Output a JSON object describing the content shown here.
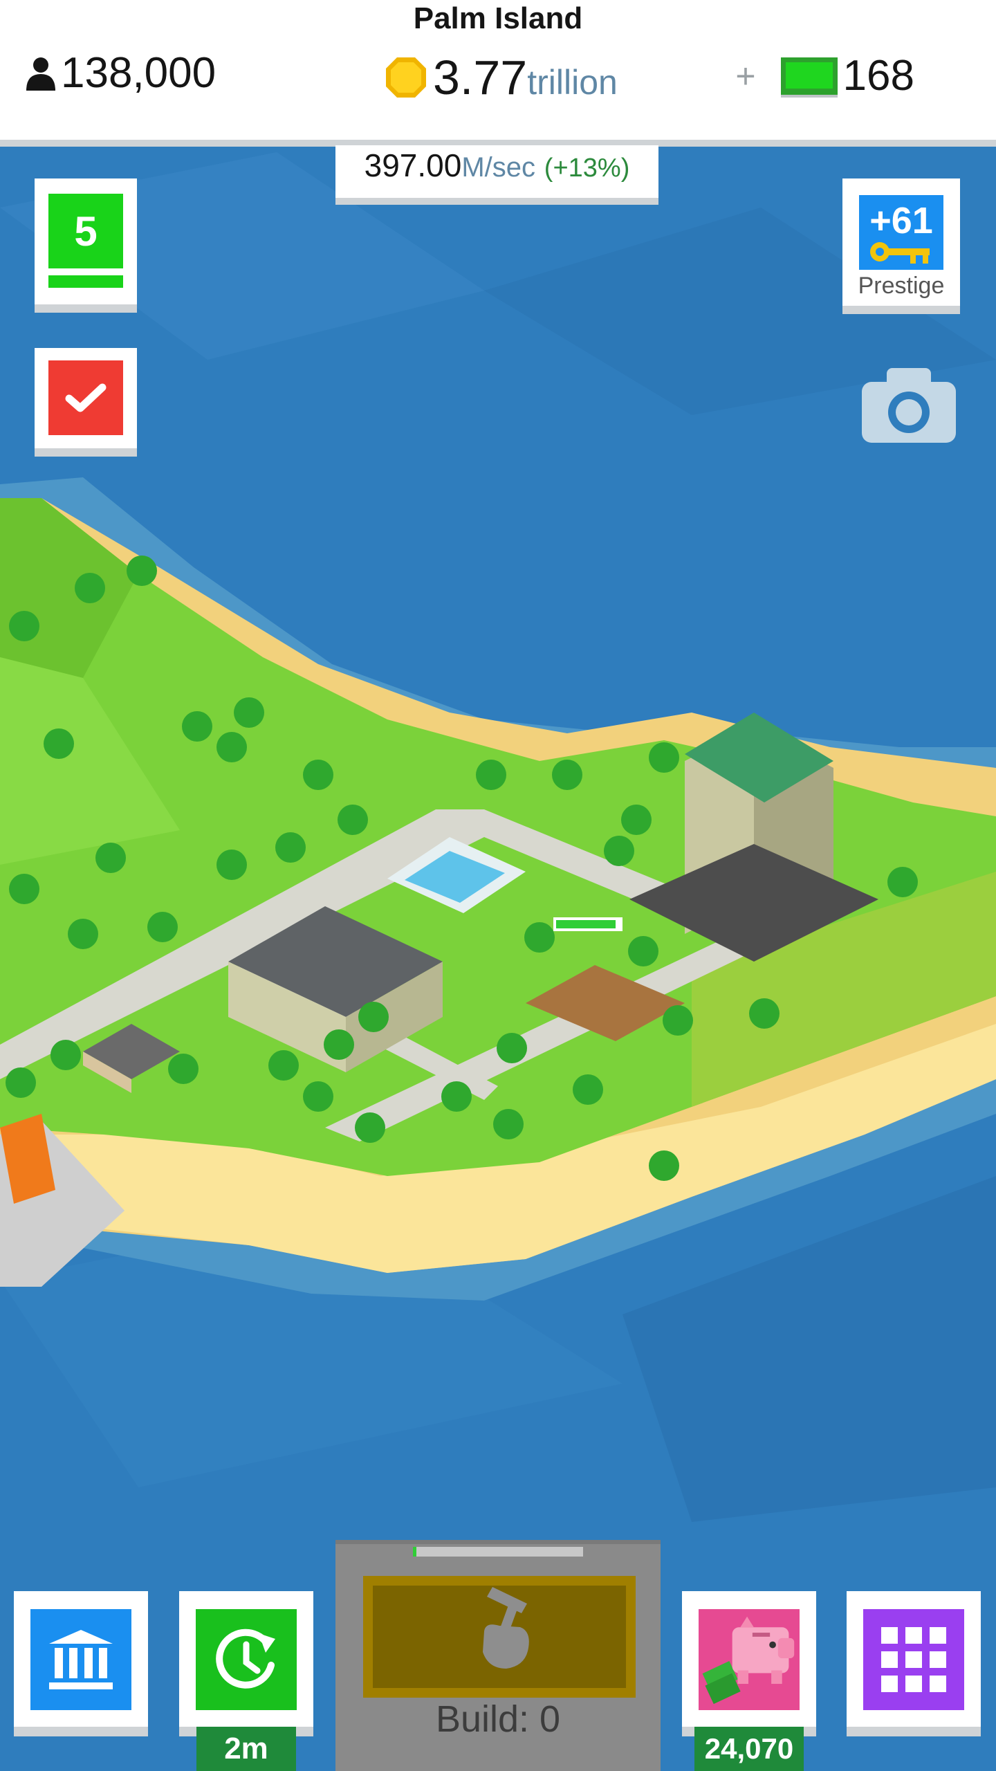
{
  "header": {
    "island_name": "Palm Island",
    "population": "138,000",
    "coins_value": "3.77",
    "coins_unit": "trillion",
    "gems_plus": "+",
    "gems": "168"
  },
  "income": {
    "value": "397.00",
    "unit": "M/sec",
    "bonus": "(+13%)"
  },
  "side_left": {
    "level": "5"
  },
  "side_right": {
    "prestige_count": "+61",
    "prestige_label": "Prestige"
  },
  "bottom": {
    "speed_timer": "2m",
    "build_label": "Build: 0",
    "build_progress": 0.0,
    "piggy_amount": "24,070"
  },
  "colors": {
    "ocean": "#2f7dbd",
    "grass": "#7bd23a",
    "sand": "#f7d98a",
    "green_accent": "#19d319",
    "blue_accent": "#1a8ff0",
    "purple_accent": "#9a3ff0",
    "pink_accent": "#e64a92",
    "red_accent": "#ef3b33"
  },
  "icons": [
    "person-icon",
    "coin-icon",
    "gem-icon",
    "check-icon",
    "key-icon",
    "camera-icon",
    "bank-icon",
    "clock-icon",
    "hammer-hand-icon",
    "piggy-bank-icon",
    "grid-icon"
  ]
}
